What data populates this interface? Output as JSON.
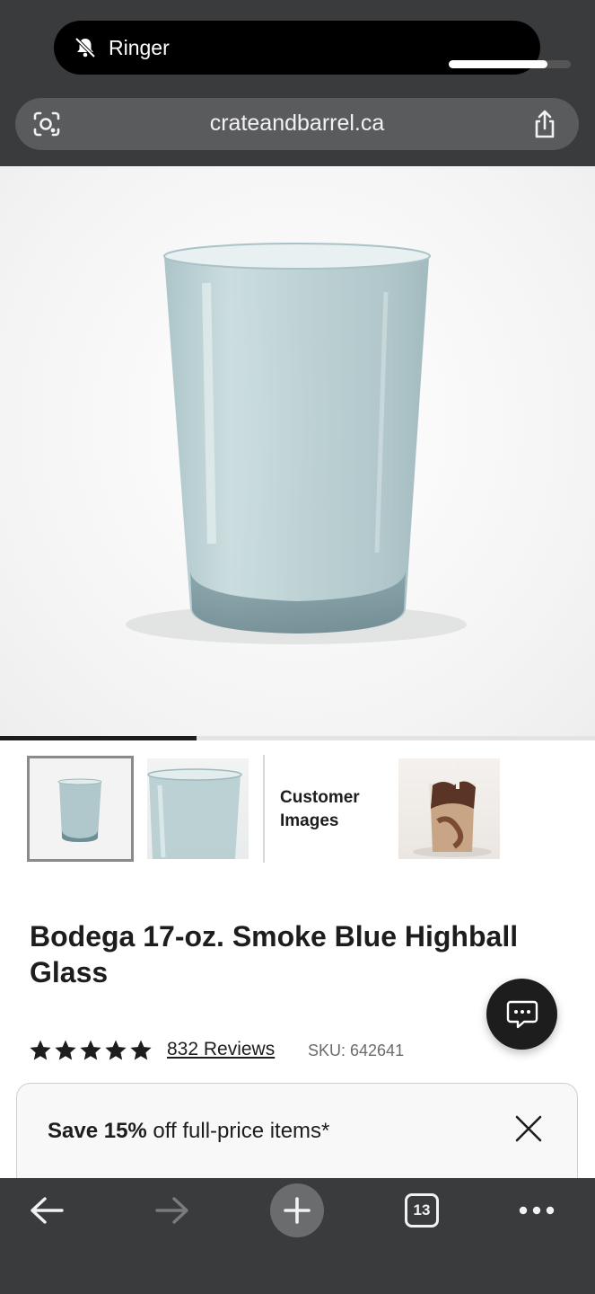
{
  "status_overlay": {
    "label": "Ringer",
    "volume_fraction": 0.81
  },
  "browser": {
    "url": "crateandbarrel.ca"
  },
  "gallery": {
    "progress_fraction": 0.33,
    "customer_images_label": "Customer Images"
  },
  "product": {
    "title": "Bodega 17-oz. Smoke Blue Highball Glass",
    "rating_stars": 5,
    "reviews_label": "832 Reviews",
    "sku_label": "SKU: 642641"
  },
  "promo": {
    "bold_text": "Save 15%",
    "rest_text": " off full-price items*"
  },
  "toolbar": {
    "tab_count": "13"
  },
  "icons": {
    "ringer": "bell-slash-icon",
    "lens": "lens-icon",
    "share": "share-icon",
    "chat": "chat-icon",
    "close": "close-icon",
    "back": "back-arrow-icon",
    "forward": "forward-arrow-icon",
    "new_tab": "plus-icon",
    "tabs": "tabs-icon",
    "more": "more-icon"
  },
  "colors": {
    "chrome_bg": "#3a3b3c",
    "text_primary": "#1d1d1d",
    "glass_tint": "#a9c5c9"
  }
}
